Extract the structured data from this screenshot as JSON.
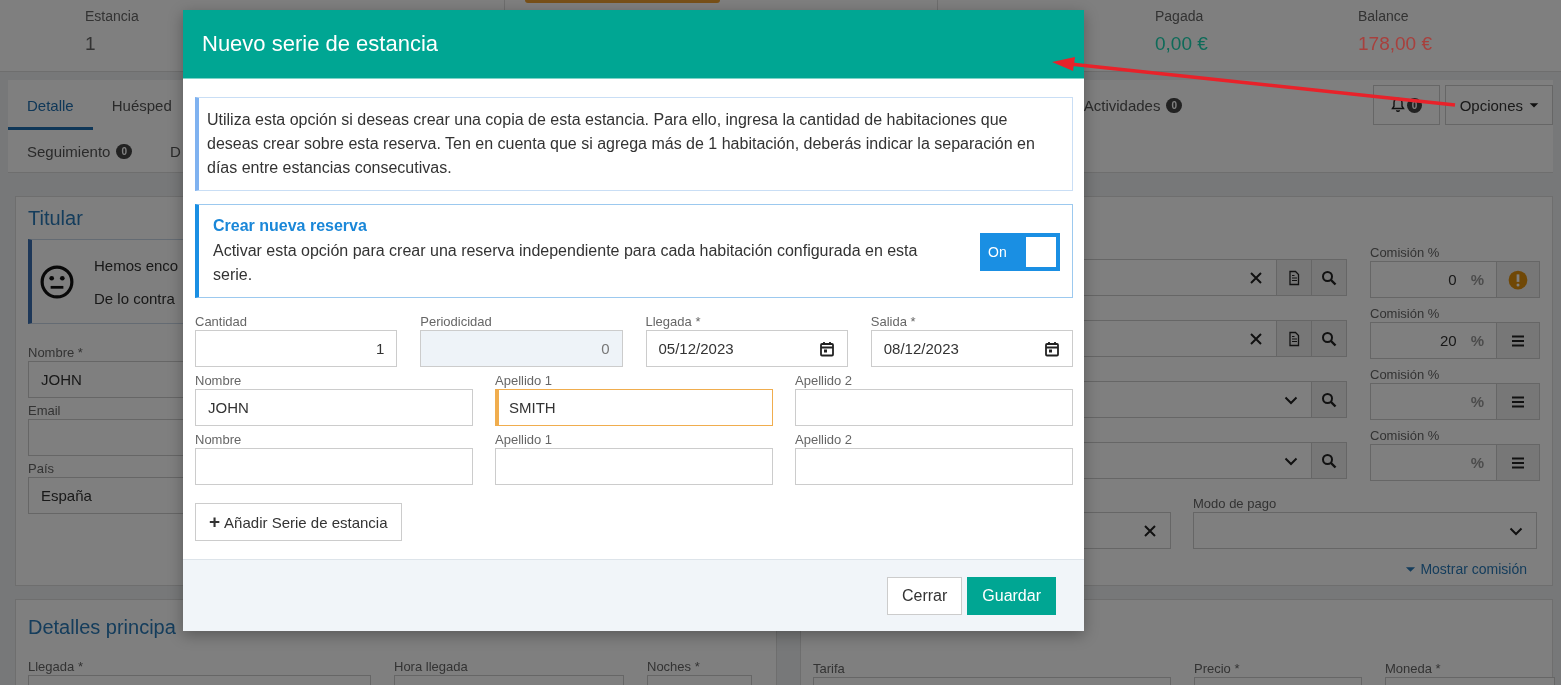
{
  "stats": [
    {
      "label": "Estancia",
      "value": "1",
      "color": "#333333"
    },
    {
      "label": "Pagada",
      "value": "0,00 €",
      "color": "#0e6b59"
    },
    {
      "label": "Balance",
      "value": "178,00 €",
      "color": "#a8403d"
    }
  ],
  "tab_rows": [
    {
      "tabs": [
        {
          "label": "Detalle",
          "selected": true
        },
        {
          "label": "Huésped",
          "selected": false
        },
        {
          "label": "Actividades",
          "badge": "0",
          "selected": false
        }
      ]
    },
    {
      "tabs": [
        {
          "label": "Seguimiento",
          "badge": "0",
          "selected": false
        },
        {
          "label": "D",
          "selected": false
        }
      ]
    }
  ],
  "notifications": {
    "badge": "0"
  },
  "options_button": {
    "label": "Opciones"
  },
  "titular": {
    "title": "Titular",
    "alert_lines": [
      "Hemos enco",
      "De lo contra"
    ],
    "fields": [
      {
        "label": "Nombre *",
        "value": "JOHN"
      },
      {
        "label": "Email"
      },
      {
        "label": "País",
        "value": "España"
      }
    ]
  },
  "assignments": {
    "rows": [
      {
        "kind": "clearable",
        "commission": {
          "label": "Comisión %",
          "value": "0",
          "unit": "%",
          "warning": true
        }
      },
      {
        "kind": "clearable",
        "commission": {
          "label": "Comisión %",
          "value": "20",
          "unit": "%",
          "warning": false
        }
      },
      {
        "kind": "select",
        "commission": {
          "label": "Comisión %",
          "unit": "%",
          "warning": false
        }
      },
      {
        "kind": "select",
        "commission": {
          "label": "Comisión %",
          "unit": "%",
          "warning": false
        }
      }
    ],
    "payment_fields": [
      {
        "kind": "clearable"
      },
      {
        "label": "Modo de pago",
        "kind": "select"
      }
    ],
    "toggle_link": {
      "label": "Mostrar comisión",
      "expanded": false
    }
  },
  "details_left": {
    "title": "Detalles principa",
    "fields": [
      {
        "label": "Llegada *"
      },
      {
        "label": "Hora llegada"
      },
      {
        "label": "Noches *"
      }
    ]
  },
  "details_right": {
    "fields": [
      {
        "label": "Tarifa"
      },
      {
        "label": "Precio *"
      },
      {
        "label": "Moneda *"
      }
    ]
  },
  "modal": {
    "title": "Nuevo serie de estancia",
    "info": "Utiliza esta opción si deseas crear una copia de esta estancia. Para ello, ingresa la cantidad de habitaciones que deseas crear sobre esta reserva. Ten en cuenta que si agrega más de 1 habitación, deberás indicar la separación en días entre estancias consecutivas.",
    "option": {
      "title": "Crear nueva reserva",
      "text": "Activar esta opción para crear una reserva independiente para cada habitación configurada en esta serie.",
      "toggle": {
        "label": "On",
        "on": true
      }
    },
    "series_fields": [
      {
        "label": "Cantidad",
        "value": "1",
        "kind": "number",
        "disabled": false
      },
      {
        "label": "Periodicidad",
        "value": "0",
        "kind": "number",
        "disabled": true
      },
      {
        "label": "Llegada *",
        "value": "05/12/2023",
        "kind": "date",
        "disabled": false
      },
      {
        "label": "Salida *",
        "value": "08/12/2023",
        "kind": "date",
        "disabled": false
      }
    ],
    "guest_rows": [
      {
        "fields": [
          {
            "label": "Nombre",
            "value": "JOHN",
            "focused": false
          },
          {
            "label": "Apellido 1",
            "value": "SMITH",
            "focused": true
          },
          {
            "label": "Apellido 2",
            "focused": false
          }
        ]
      },
      {
        "fields": [
          {
            "label": "Nombre",
            "focused": false
          },
          {
            "label": "Apellido 1",
            "focused": false
          },
          {
            "label": "Apellido 2",
            "focused": false
          }
        ]
      }
    ],
    "add_button": {
      "icon": "+",
      "label": "Añadir Serie de estancia"
    },
    "buttons": [
      {
        "label": "Cerrar",
        "kind": "secondary"
      },
      {
        "label": "Guardar",
        "kind": "primary"
      }
    ]
  }
}
